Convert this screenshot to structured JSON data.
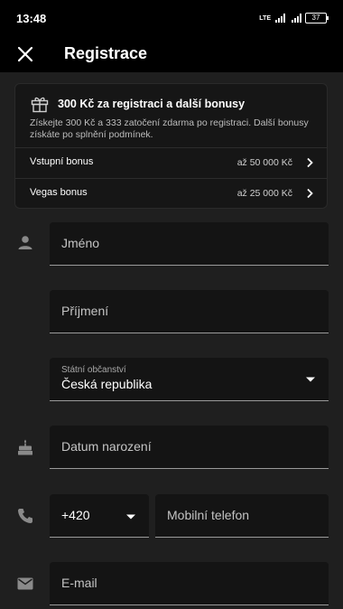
{
  "status_bar": {
    "time": "13:48",
    "battery": "37",
    "network": "LTE"
  },
  "header": {
    "title": "Registrace",
    "close_icon": "close-icon"
  },
  "promo": {
    "icon": "gift-icon",
    "title": "300 Kč za registraci a další bonusy",
    "description": "Získejte 300 Kč a 333 zatočení zdarma po registraci. Další bonusy získáte po splnění podmínek.",
    "items": [
      {
        "label": "Vstupní bonus",
        "amount": "až 50 000 Kč"
      },
      {
        "label": "Vegas bonus",
        "amount": "až 25 000 Kč"
      }
    ]
  },
  "form": {
    "first_name": {
      "placeholder": "Jméno",
      "icon": "person-icon"
    },
    "last_name": {
      "placeholder": "Příjmení"
    },
    "citizenship": {
      "label": "Státní občanství",
      "value": "Česká republika"
    },
    "birth_date": {
      "placeholder": "Datum narození",
      "icon": "cake-icon"
    },
    "phone_prefix": {
      "value": "+420",
      "icon": "phone-icon"
    },
    "mobile": {
      "placeholder": "Mobilní telefon"
    },
    "email": {
      "placeholder": "E-mail",
      "icon": "mail-icon"
    }
  },
  "colors": {
    "background": "#1f1f1f",
    "bar": "#000000",
    "field": "#141414",
    "text": "#ffffff"
  }
}
